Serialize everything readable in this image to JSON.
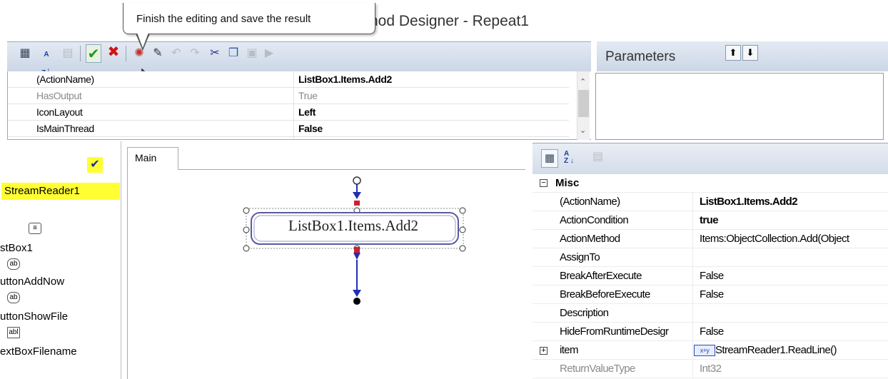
{
  "window": {
    "title_fragment": "hod Designer - Repeat1"
  },
  "tooltip": {
    "text": "Finish the editing and save the result"
  },
  "toolbar": {
    "buttons": [
      {
        "name": "categorized-icon",
        "glyph": "▦"
      },
      {
        "name": "alphabetical-sort-icon",
        "glyph": "↓"
      },
      {
        "name": "property-pages-icon",
        "glyph": "▤"
      },
      {
        "name": "finish-save-icon",
        "glyph": "✔"
      },
      {
        "name": "cancel-icon",
        "glyph": "✖"
      },
      {
        "name": "debug-icon",
        "glyph": "✺"
      },
      {
        "name": "magic-wand-icon",
        "glyph": "✎"
      },
      {
        "name": "undo-icon",
        "glyph": "↶"
      },
      {
        "name": "redo-icon",
        "glyph": "↷"
      },
      {
        "name": "cut-icon",
        "glyph": "✂"
      },
      {
        "name": "copy-icon",
        "glyph": "❐"
      },
      {
        "name": "paste-icon",
        "glyph": "▣"
      },
      {
        "name": "run-icon",
        "glyph": "▶"
      }
    ]
  },
  "action_properties": {
    "rows": [
      {
        "name": "(ActionName)",
        "value": "ListBox1.Items.Add2",
        "bold": true,
        "gray": false
      },
      {
        "name": "HasOutput",
        "value": "True",
        "bold": false,
        "gray": true
      },
      {
        "name": "IconLayout",
        "value": "Left",
        "bold": true,
        "gray": false
      },
      {
        "name": "IsMainThread",
        "value": "False",
        "bold": true,
        "gray": false
      }
    ]
  },
  "parameters": {
    "label": "Parameters",
    "up_icon": "up-arrow-icon",
    "down_icon": "down-arrow-icon"
  },
  "components": {
    "selected": "StreamReader1",
    "items": [
      {
        "label": "stBox1",
        "icon": "listbox-icon",
        "icon_text": "≡"
      },
      {
        "label": "uttonAddNow",
        "icon": "button-icon",
        "icon_text": "ab"
      },
      {
        "label": "uttonShowFile",
        "icon": "button-icon",
        "icon_text": "ab"
      },
      {
        "label": "extBoxFilename",
        "icon": "textbox-icon",
        "icon_text": "abl"
      }
    ]
  },
  "canvas": {
    "tab_label": "Main",
    "action_node_label": "ListBox1.Items.Add2"
  },
  "misc_properties": {
    "category": "Misc",
    "rows": [
      {
        "name": "(ActionName)",
        "value": "ListBox1.Items.Add2",
        "bold_value": true,
        "expander": ""
      },
      {
        "name": "ActionCondition",
        "value": "true",
        "bold_value": true,
        "expander": ""
      },
      {
        "name": "ActionMethod",
        "value": "Items:ObjectCollection.Add(Object",
        "bold_value": false,
        "expander": ""
      },
      {
        "name": "AssignTo",
        "value": "",
        "bold_value": false,
        "expander": ""
      },
      {
        "name": "BreakAfterExecute",
        "value": "False",
        "bold_value": false,
        "expander": ""
      },
      {
        "name": "BreakBeforeExecute",
        "value": "False",
        "bold_value": false,
        "expander": ""
      },
      {
        "name": "Description",
        "value": "",
        "bold_value": false,
        "expander": ""
      },
      {
        "name": "HideFromRuntimeDesigr",
        "value": "False",
        "bold_value": false,
        "expander": ""
      },
      {
        "name": "item",
        "value": "StreamReader1.ReadLine()",
        "bold_value": false,
        "expander": "+",
        "value_icon": "method-icon",
        "value_icon_text": "x+y"
      },
      {
        "name": "ReturnValueType",
        "value": "Int32",
        "bold_value": false,
        "expander": "",
        "gray": true
      }
    ]
  }
}
